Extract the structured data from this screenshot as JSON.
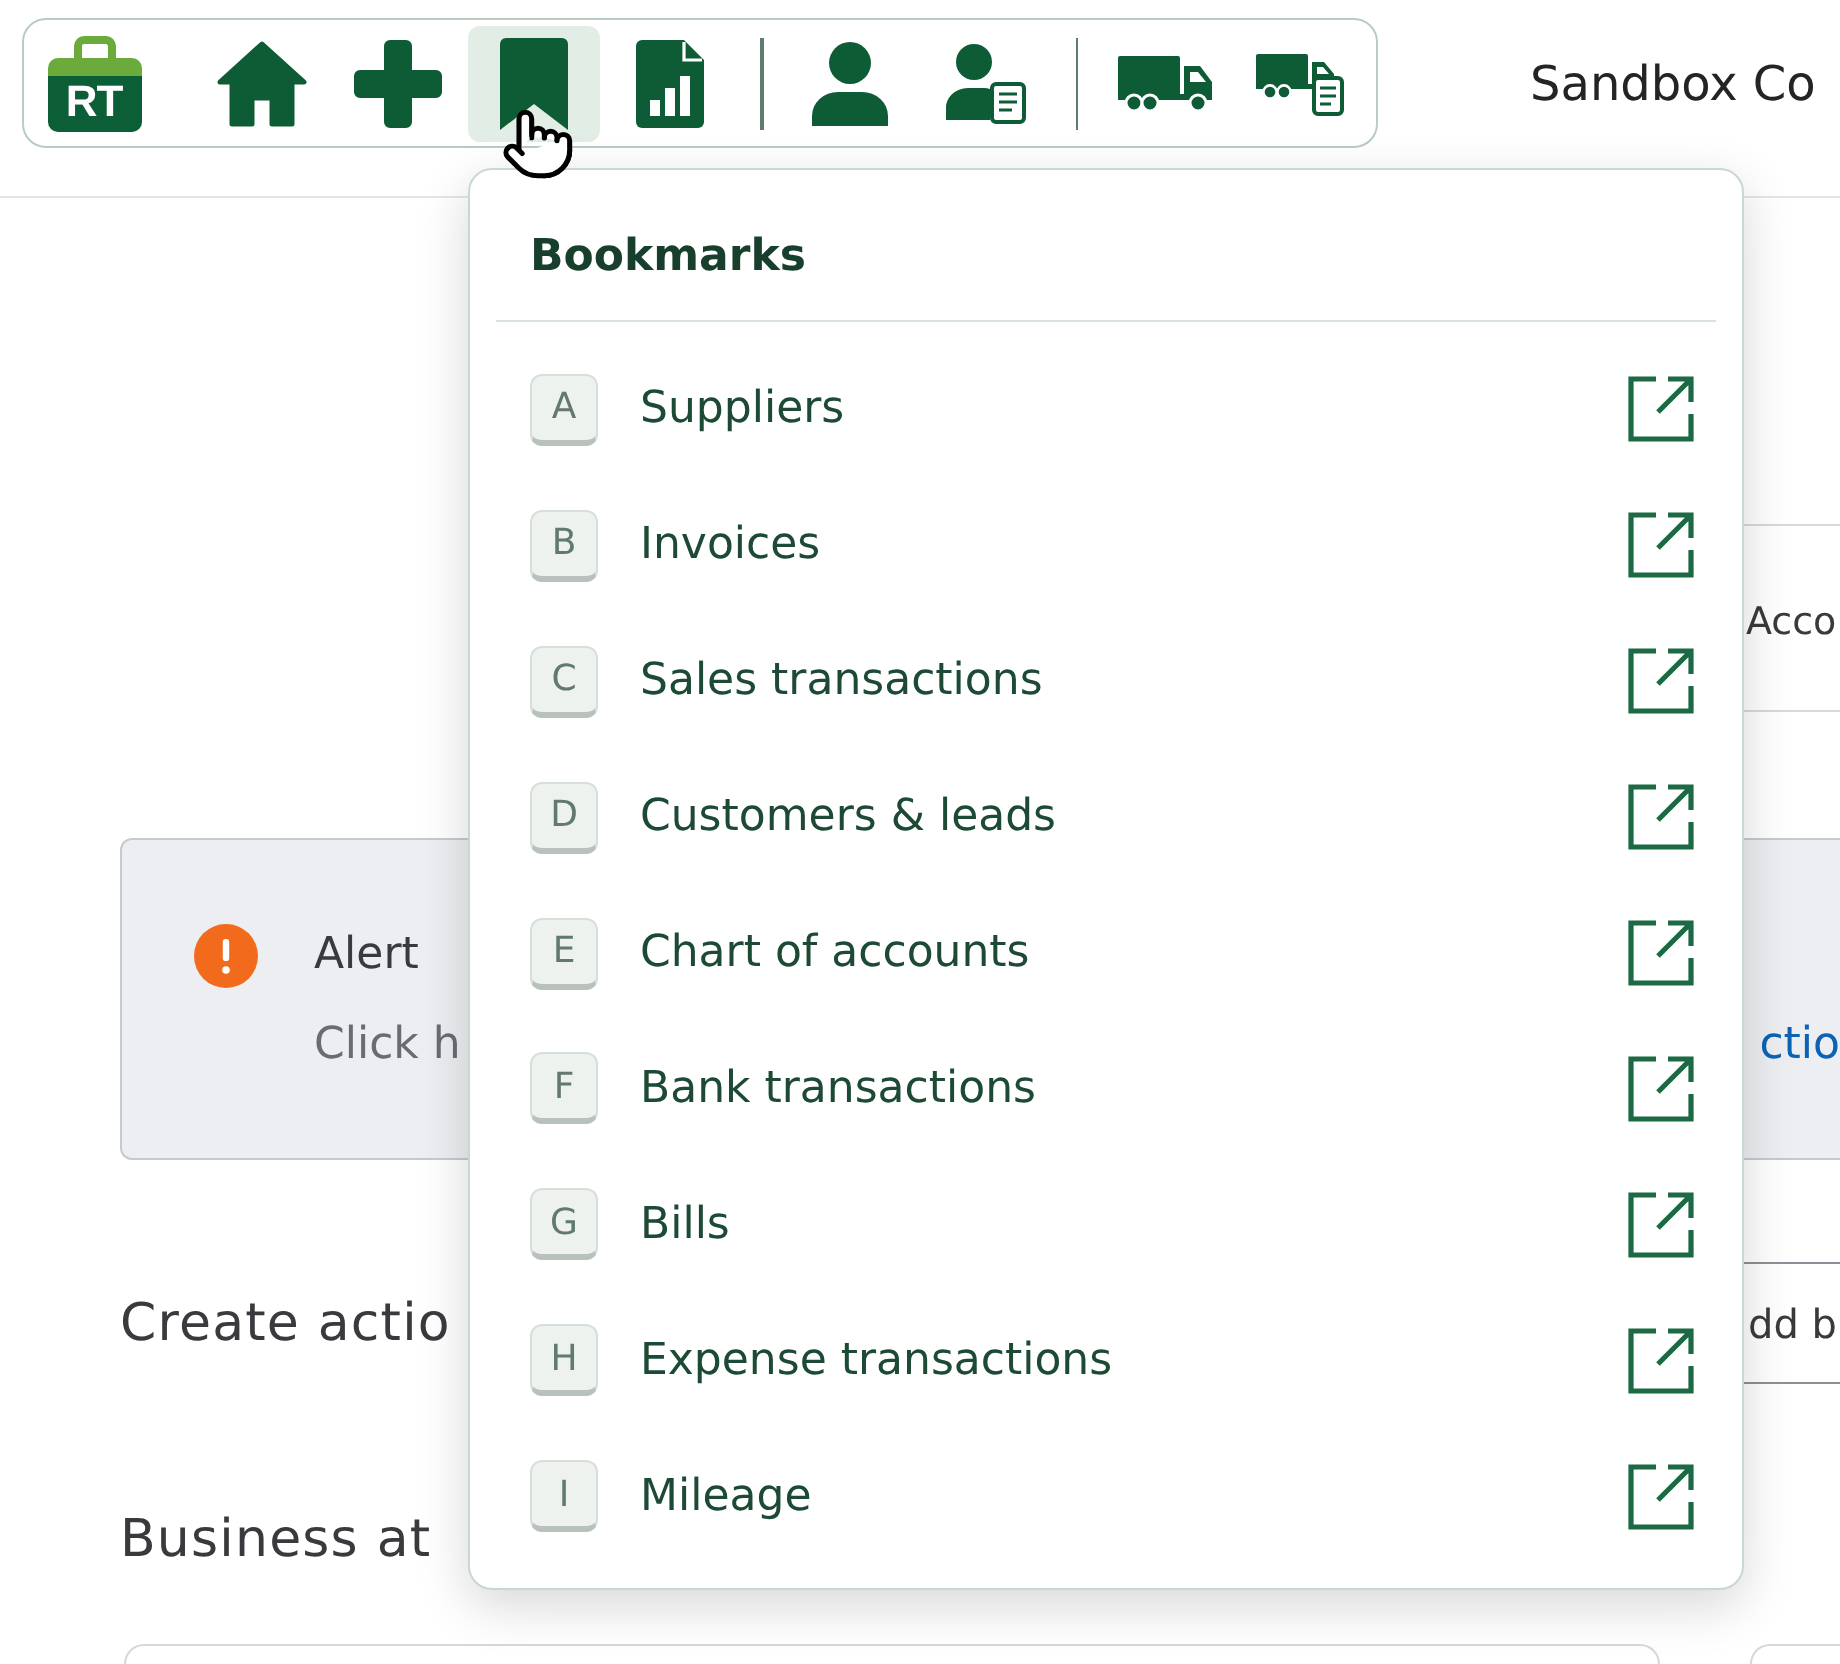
{
  "toolbar": {
    "logo": "RT",
    "groups": [
      {
        "buttons": [
          {
            "kind": "home",
            "selected": false
          },
          {
            "kind": "add",
            "selected": false
          },
          {
            "kind": "bookmarks",
            "selected": true
          },
          {
            "kind": "reports",
            "selected": false
          }
        ]
      },
      {
        "buttons": [
          {
            "kind": "person",
            "selected": false
          },
          {
            "kind": "person_document",
            "selected": false
          }
        ]
      },
      {
        "buttons": [
          {
            "kind": "truck",
            "selected": false
          },
          {
            "kind": "truck_document",
            "selected": false
          }
        ]
      }
    ]
  },
  "company_name": "Sandbox Co",
  "bookmarks_menu": {
    "title": "Bookmarks",
    "items": [
      {
        "key": "A",
        "label": "Suppliers"
      },
      {
        "key": "B",
        "label": "Invoices"
      },
      {
        "key": "C",
        "label": "Sales transactions"
      },
      {
        "key": "D",
        "label": "Customers & leads"
      },
      {
        "key": "E",
        "label": "Chart of accounts"
      },
      {
        "key": "F",
        "label": "Bank transactions"
      },
      {
        "key": "G",
        "label": "Bills"
      },
      {
        "key": "H",
        "label": "Expense transactions"
      },
      {
        "key": "I",
        "label": "Mileage"
      }
    ]
  },
  "page": {
    "tab": "Acco",
    "alert": {
      "title": "Alert",
      "text": "Click h",
      "link": "ctio"
    },
    "create_actions": {
      "heading": "Create actio",
      "button": "dd b"
    },
    "business_heading": "Business at"
  }
}
